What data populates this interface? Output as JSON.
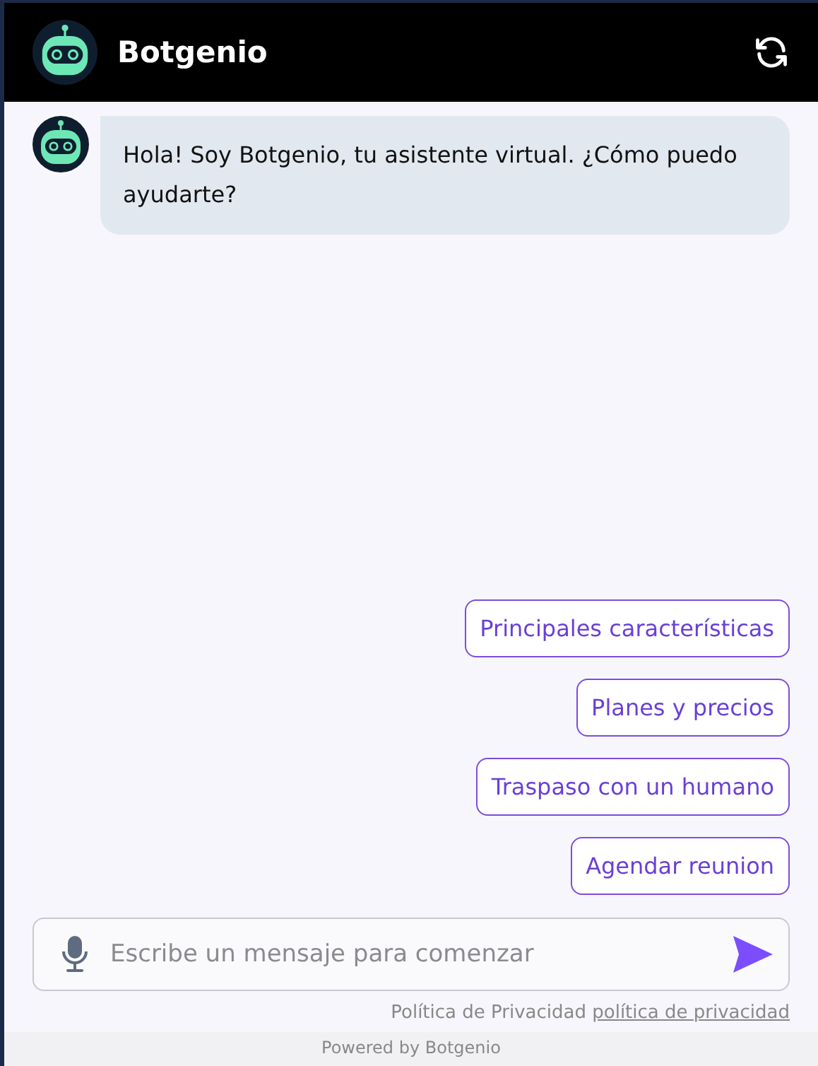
{
  "header": {
    "title": "Botgenio"
  },
  "messages": [
    {
      "text": "Hola! Soy Botgenio, tu asistente virtual. ¿Cómo puedo ayudarte?"
    }
  ],
  "quick_replies": [
    "Principales características",
    "Planes y precios",
    "Traspaso con un humano",
    "Agendar reunion"
  ],
  "composer": {
    "placeholder": "Escribe un mensaje para comenzar"
  },
  "privacy": {
    "text": "Política de Privacidad",
    "link": "política de privacidad"
  },
  "footer": "Powered by Botgenio"
}
